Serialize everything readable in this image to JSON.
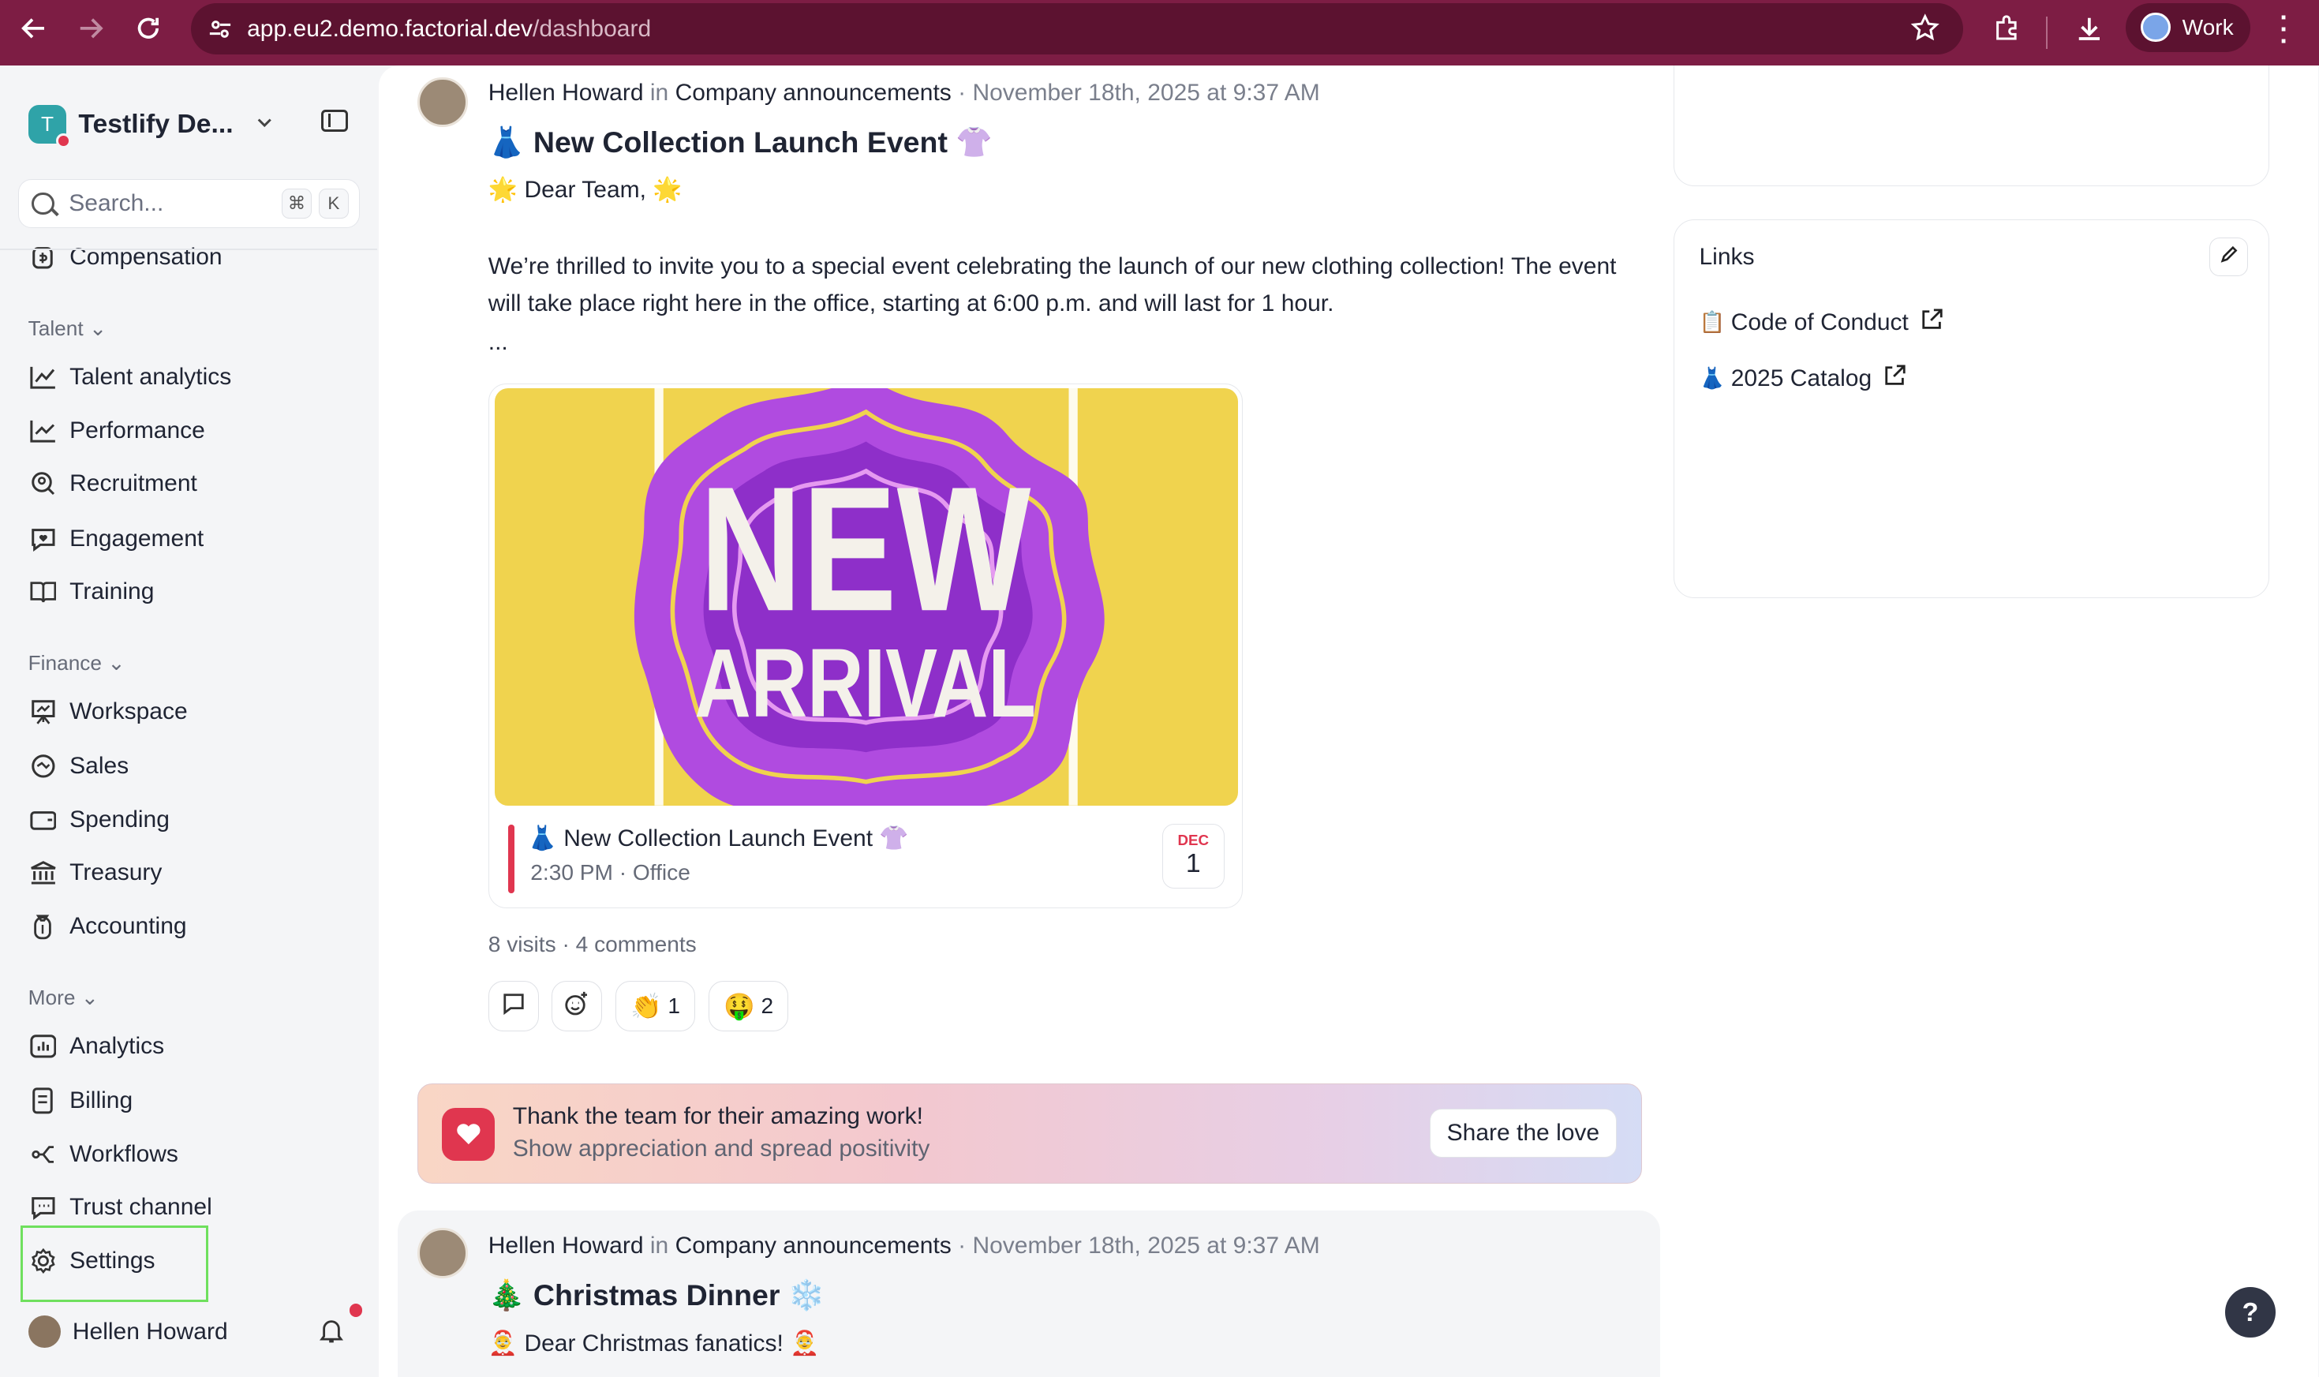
{
  "browser": {
    "url_host": "app.eu2.demo.factorial.dev",
    "url_path": "/dashboard",
    "profile_label": "Work"
  },
  "sidebar": {
    "workspace_name": "Testlify De...",
    "workspace_initial": "T",
    "search_placeholder": "Search...",
    "search_shortcut_cmd": "⌘",
    "search_shortcut_key": "K",
    "top_item": "Compensation",
    "sections": {
      "talent": "Talent",
      "finance": "Finance",
      "more": "More"
    },
    "talent_items": [
      "Talent analytics",
      "Performance",
      "Recruitment",
      "Engagement",
      "Training"
    ],
    "finance_items": [
      "Workspace",
      "Sales",
      "Spending",
      "Treasury",
      "Accounting"
    ],
    "more_items": [
      "Analytics",
      "Billing",
      "Workflows",
      "Trust channel",
      "Settings"
    ],
    "user_name": "Hellen Howard"
  },
  "posts": [
    {
      "author": "Hellen Howard",
      "in_word": "in",
      "channel": "Company announcements",
      "timestamp": "· November 18th, 2025 at 9:37 AM",
      "title": "👗 New Collection Launch Event 👚",
      "greeting": "🌟 Dear Team, 🌟",
      "body": "We’re thrilled to invite you to a special event celebrating the launch of our new clothing collection! The event will take place right here in the office, starting at 6:00 p.m. and will last for 1 hour.",
      "ellipsis": "...",
      "banner_line1": "NEW",
      "banner_line2": "ARRIVAL",
      "event_title": "👗 New Collection Launch Event 👚",
      "event_sub": "2:30 PM · Office",
      "event_month": "DEC",
      "event_day": "1",
      "stats": "8 visits · 4 comments",
      "reactions": [
        {
          "emoji": "👏",
          "count": "1"
        },
        {
          "emoji": "🤑",
          "count": "2"
        }
      ]
    },
    {
      "author": "Hellen Howard",
      "in_word": "in",
      "channel": "Company announcements",
      "timestamp": "· November 18th, 2025 at 9:37 AM",
      "title": "🎄 Christmas Dinner ❄️",
      "greeting": "🤶 Dear Christmas fanatics! 🤶"
    }
  ],
  "promo": {
    "title": "Thank the team for their amazing work!",
    "subtitle": "Show appreciation and spread positivity",
    "button": "Share the love"
  },
  "links": {
    "title": "Links",
    "items": [
      {
        "icon": "📋",
        "label": "Code of Conduct"
      },
      {
        "icon": "👗",
        "label": "2025 Catalog"
      }
    ]
  },
  "help_label": "?"
}
